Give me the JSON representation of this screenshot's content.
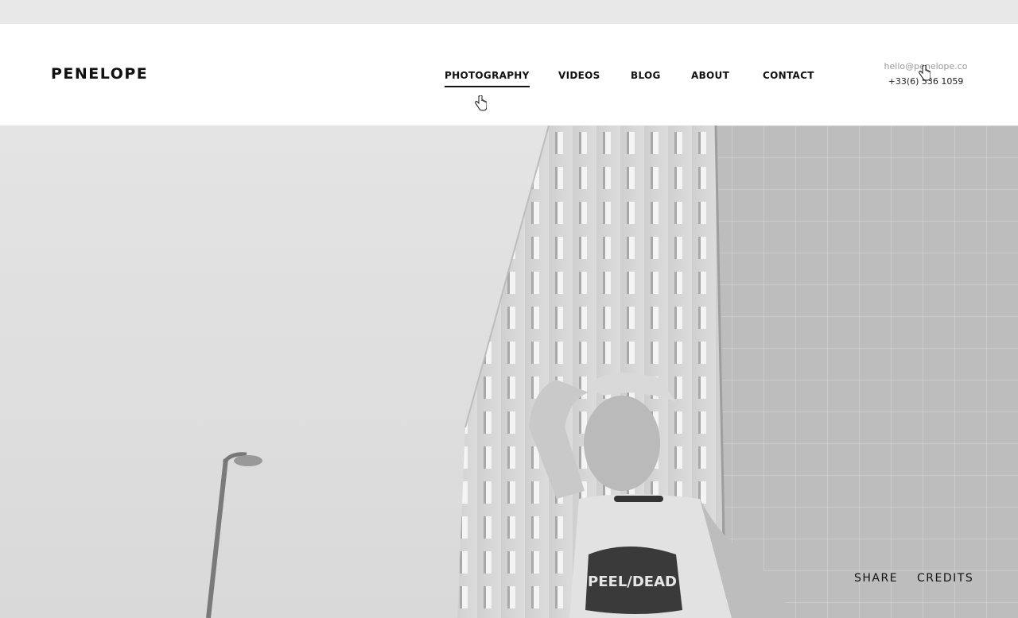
{
  "brand": {
    "name": "PENELOPE"
  },
  "nav": {
    "items": [
      {
        "label": "PHOTOGRAPHY",
        "active": true
      },
      {
        "label": "VIDEOS"
      },
      {
        "label": "BLOG"
      },
      {
        "label": "ABOUT"
      },
      {
        "label": "CONTACT"
      }
    ]
  },
  "contact": {
    "email": "hello@penelope.co",
    "phone": "+33(6) 536 1059"
  },
  "hero": {
    "image": "black-and-white-photo-woman-in-front-of-apartment-building",
    "shirt_text": "PEEL/DEAD"
  },
  "footer": {
    "share_label": "SHARE",
    "credits_label": "CREDITS"
  },
  "icons": {
    "cursor": "hand-pointer-icon"
  },
  "colors": {
    "text": "#111111",
    "muted": "#9a9a9a",
    "header_bg": "#ffffff"
  }
}
